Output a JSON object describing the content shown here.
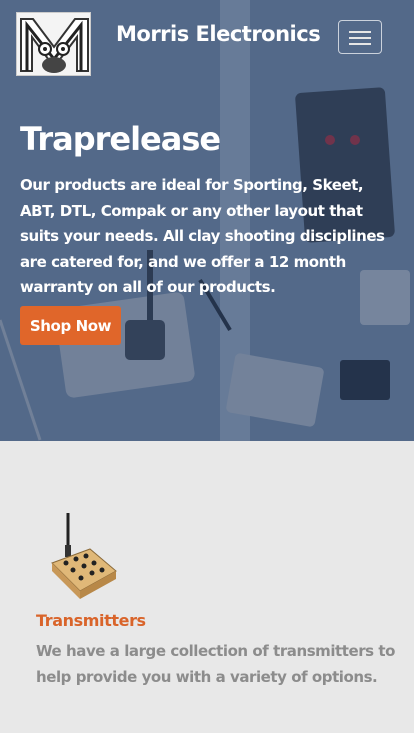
{
  "navbar": {
    "brand": "Morris Electronics",
    "logo_icon": "morris-m-logo-icon",
    "toggle_icon": "hamburger-menu-icon"
  },
  "hero": {
    "title": "Traprelease",
    "text": "Our products are ideal for Sporting, Skeet, ABT, DTL, Compak or any other layout that suits your needs. All clay shooting disciplines are catered for, and we offer a 12 month warranty on all of our products.",
    "button_label": "Shop Now"
  },
  "features": {
    "items": [
      {
        "icon": "transmitter-icon",
        "title": "Transmitters",
        "text": "We have a large collection of transmitters to help provide you with a variety of options."
      }
    ]
  },
  "colors": {
    "accent": "#e0662a",
    "hero_overlay": "#26426e",
    "section_bg": "#e8e8e8",
    "muted_text": "#8c8c8c"
  }
}
